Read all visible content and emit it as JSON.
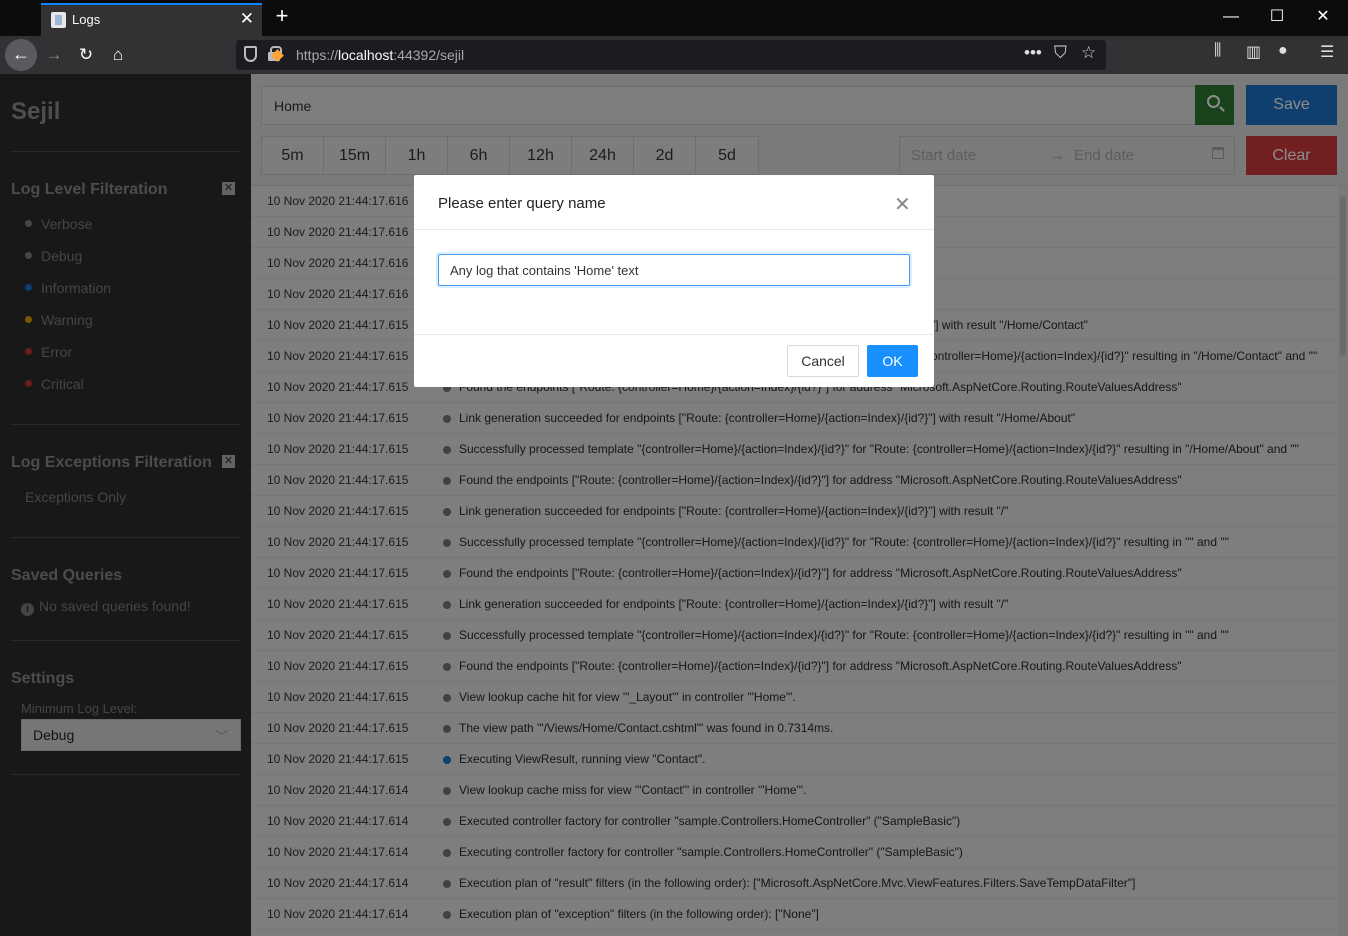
{
  "browser": {
    "tab_title": "Logs",
    "url_scheme": "https://",
    "url_host": "localhost",
    "url_path": ":44392/sejil"
  },
  "sidebar": {
    "brand": "Sejil",
    "level_heading": "Log Level Filteration",
    "levels": [
      {
        "label": "Verbose",
        "color": "#7e7e7e"
      },
      {
        "label": "Debug",
        "color": "#7e7e7e"
      },
      {
        "label": "Information",
        "color": "#1a6fd0"
      },
      {
        "label": "Warning",
        "color": "#e0a000"
      },
      {
        "label": "Error",
        "color": "#c8323a"
      },
      {
        "label": "Critical",
        "color": "#c8323a"
      }
    ],
    "exceptions_heading": "Log Exceptions Filteration",
    "exceptions_only": "Exceptions Only",
    "saved_heading": "Saved Queries",
    "no_saved": "No saved queries found!",
    "settings_heading": "Settings",
    "min_level_label": "Minimum Log Level:",
    "min_level_value": "Debug"
  },
  "toolbar": {
    "query_value": "Home",
    "save_label": "Save",
    "clear_label": "Clear",
    "ranges": [
      "5m",
      "15m",
      "1h",
      "6h",
      "12h",
      "24h",
      "2d",
      "5d"
    ],
    "start_placeholder": "Start date",
    "end_placeholder": "End date"
  },
  "logs": [
    {
      "ts": "10 Nov 2020 21:44:17.616",
      "msg": "",
      "level_color": "#777777"
    },
    {
      "ts": "10 Nov 2020 21:44:17.616",
      "msg": "",
      "level_color": "#777777"
    },
    {
      "ts": "10 Nov 2020 21:44:17.616",
      "msg": "",
      "level_color": "#777777"
    },
    {
      "ts": "10 Nov 2020 21:44:17.616",
      "msg": "",
      "level_color": "#777777"
    },
    {
      "ts": "10 Nov 2020 21:44:17.615",
      "msg": "\"] with result \"/Home/Contact\"",
      "level_color": "#777777"
    },
    {
      "ts": "10 Nov 2020 21:44:17.615",
      "msg": "ontroller=Home}/{action=Index}/{id?}\" resulting in \"/Home/Contact\" and \"\"",
      "level_color": "#777777"
    },
    {
      "ts": "10 Nov 2020 21:44:17.615",
      "msg": "Found the endpoints [\"Route: {controller=Home}/{action=Index}/{id?}\"] for address \"Microsoft.AspNetCore.Routing.RouteValuesAddress\"",
      "level_color": "#777777"
    },
    {
      "ts": "10 Nov 2020 21:44:17.615",
      "msg": "Link generation succeeded for endpoints [\"Route: {controller=Home}/{action=Index}/{id?}\"] with result \"/Home/About\"",
      "level_color": "#777777"
    },
    {
      "ts": "10 Nov 2020 21:44:17.615",
      "msg": "Successfully processed template \"{controller=Home}/{action=Index}/{id?}\" for \"Route: {controller=Home}/{action=Index}/{id?}\" resulting in \"/Home/About\" and \"\"",
      "level_color": "#777777"
    },
    {
      "ts": "10 Nov 2020 21:44:17.615",
      "msg": "Found the endpoints [\"Route: {controller=Home}/{action=Index}/{id?}\"] for address \"Microsoft.AspNetCore.Routing.RouteValuesAddress\"",
      "level_color": "#777777"
    },
    {
      "ts": "10 Nov 2020 21:44:17.615",
      "msg": "Link generation succeeded for endpoints [\"Route: {controller=Home}/{action=Index}/{id?}\"] with result \"/\"",
      "level_color": "#777777"
    },
    {
      "ts": "10 Nov 2020 21:44:17.615",
      "msg": "Successfully processed template \"{controller=Home}/{action=Index}/{id?}\" for \"Route: {controller=Home}/{action=Index}/{id?}\" resulting in \"\" and \"\"",
      "level_color": "#777777"
    },
    {
      "ts": "10 Nov 2020 21:44:17.615",
      "msg": "Found the endpoints [\"Route: {controller=Home}/{action=Index}/{id?}\"] for address \"Microsoft.AspNetCore.Routing.RouteValuesAddress\"",
      "level_color": "#777777"
    },
    {
      "ts": "10 Nov 2020 21:44:17.615",
      "msg": "Link generation succeeded for endpoints [\"Route: {controller=Home}/{action=Index}/{id?}\"] with result \"/\"",
      "level_color": "#777777"
    },
    {
      "ts": "10 Nov 2020 21:44:17.615",
      "msg": "Successfully processed template \"{controller=Home}/{action=Index}/{id?}\" for \"Route: {controller=Home}/{action=Index}/{id?}\" resulting in \"\" and \"\"",
      "level_color": "#777777"
    },
    {
      "ts": "10 Nov 2020 21:44:17.615",
      "msg": "Found the endpoints [\"Route: {controller=Home}/{action=Index}/{id?}\"] for address \"Microsoft.AspNetCore.Routing.RouteValuesAddress\"",
      "level_color": "#777777"
    },
    {
      "ts": "10 Nov 2020 21:44:17.615",
      "msg": "View lookup cache hit for view '\"_Layout\"' in controller '\"Home\"'.",
      "level_color": "#777777"
    },
    {
      "ts": "10 Nov 2020 21:44:17.615",
      "msg": "The view path '\"/Views/Home/Contact.cshtml\"' was found in 0.7314ms.",
      "level_color": "#777777"
    },
    {
      "ts": "10 Nov 2020 21:44:17.615",
      "msg": "Executing ViewResult, running view \"Contact\".",
      "level_color": "#1a6fd0"
    },
    {
      "ts": "10 Nov 2020 21:44:17.614",
      "msg": "View lookup cache miss for view '\"Contact\"' in controller '\"Home\"'.",
      "level_color": "#777777"
    },
    {
      "ts": "10 Nov 2020 21:44:17.614",
      "msg": "Executed controller factory for controller \"sample.Controllers.HomeController\" (\"SampleBasic\")",
      "level_color": "#777777"
    },
    {
      "ts": "10 Nov 2020 21:44:17.614",
      "msg": "Executing controller factory for controller \"sample.Controllers.HomeController\" (\"SampleBasic\")",
      "level_color": "#777777"
    },
    {
      "ts": "10 Nov 2020 21:44:17.614",
      "msg": "Execution plan of \"result\" filters (in the following order): [\"Microsoft.AspNetCore.Mvc.ViewFeatures.Filters.SaveTempDataFilter\"]",
      "level_color": "#777777"
    },
    {
      "ts": "10 Nov 2020 21:44:17.614",
      "msg": "Execution plan of \"exception\" filters (in the following order): [\"None\"]",
      "level_color": "#777777"
    }
  ],
  "modal": {
    "title": "Please enter query name",
    "input_value": "Any log that contains 'Home' text",
    "cancel_label": "Cancel",
    "ok_label": "OK"
  }
}
